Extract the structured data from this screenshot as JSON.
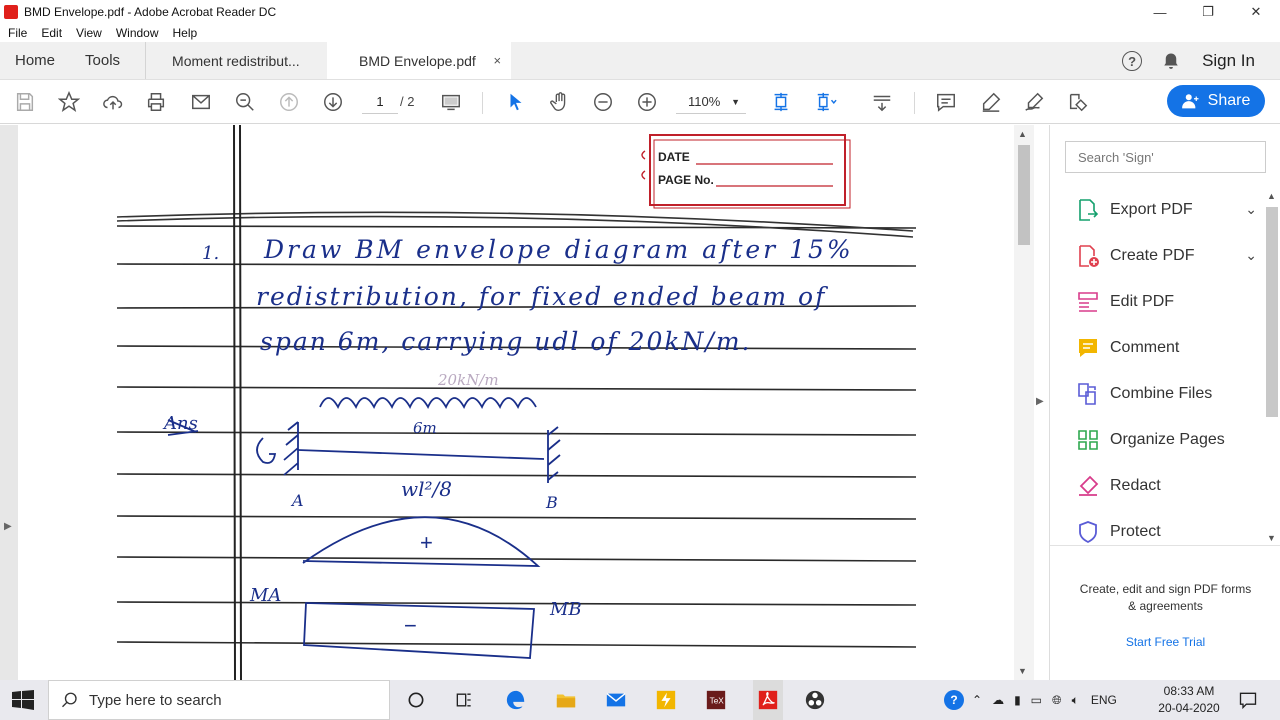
{
  "window": {
    "title": "BMD Envelope.pdf - Adobe Acrobat Reader DC"
  },
  "menu": [
    "File",
    "Edit",
    "View",
    "Window",
    "Help"
  ],
  "tabs": {
    "home": "Home",
    "tools": "Tools",
    "doc1": "Moment redistribut...",
    "doc2": "BMD Envelope.pdf",
    "close": "×",
    "sign_in": "Sign In"
  },
  "toolbar": {
    "page_current": "1",
    "page_total": "/ 2",
    "zoom": "110%",
    "share": "Share"
  },
  "document": {
    "date_label": "DATE",
    "page_label": "PAGE No.",
    "q_number": "1.",
    "q_line1": "Draw BM envelope diagram after 15%",
    "q_line2": "redistribution, for fixed ended beam of",
    "q_line3": "span 6m, carrying udl of 20kN/m.",
    "ans": "Ans",
    "load_label": "20kN/m",
    "span_label": "6m",
    "support_a": "A",
    "support_b": "B",
    "moment_label": "wl²/8",
    "plus": "+",
    "minus": "−",
    "ma": "MA",
    "mb": "MB"
  },
  "right_panel": {
    "search_placeholder": "Search 'Sign'",
    "tools": [
      {
        "label": "Export PDF",
        "color": "#14a06d"
      },
      {
        "label": "Create PDF",
        "color": "#e0404f"
      },
      {
        "label": "Edit PDF",
        "color": "#d83c8b"
      },
      {
        "label": "Comment",
        "color": "#f2b600"
      },
      {
        "label": "Combine Files",
        "color": "#5a5cd6"
      },
      {
        "label": "Organize Pages",
        "color": "#2fa84f"
      },
      {
        "label": "Redact",
        "color": "#d83c8b"
      },
      {
        "label": "Protect",
        "color": "#5a5cd6"
      }
    ],
    "promo": "Create, edit and sign PDF forms & agreements",
    "trial": "Start Free Trial"
  },
  "taskbar": {
    "search_placeholder": "Type here to search",
    "lang": "ENG",
    "time": "08:33 AM",
    "date": "20-04-2020"
  },
  "colors": {
    "accent": "#1473e6",
    "ink": "#1a2f8a"
  }
}
